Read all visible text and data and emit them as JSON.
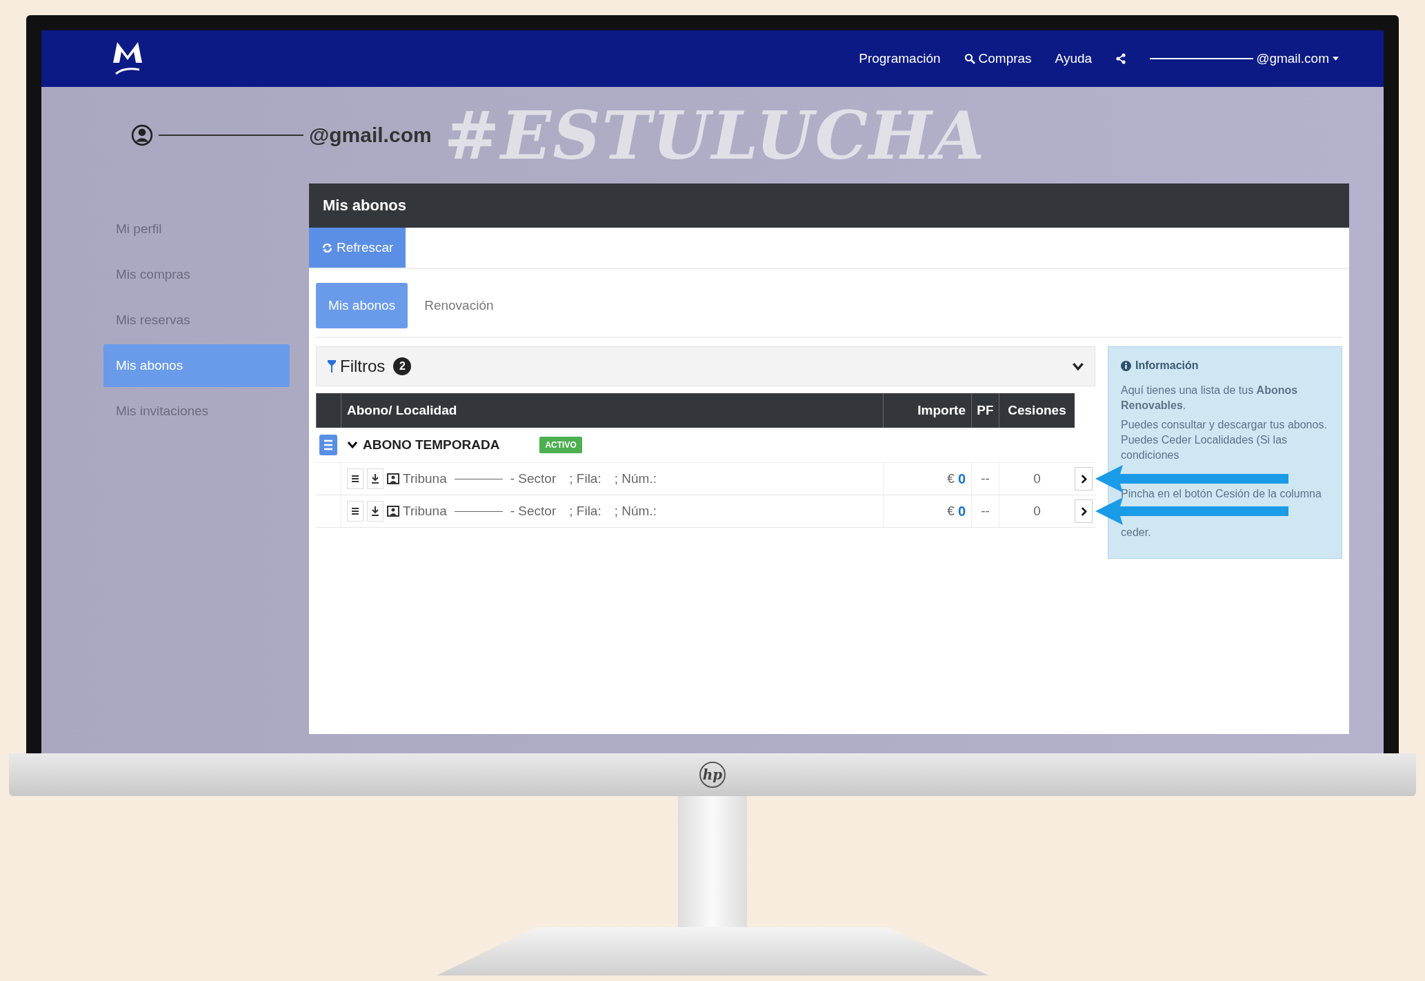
{
  "nav": {
    "links": [
      {
        "label": "Programación",
        "kind": "plain"
      },
      {
        "label": "Compras",
        "kind": "search"
      },
      {
        "label": "Ayuda",
        "kind": "plain"
      }
    ],
    "account": "@gmail.com"
  },
  "profile": {
    "email": "@gmail.com",
    "banner": "#ESTULUCHA"
  },
  "sidebar": {
    "items": [
      {
        "label": "Mi perfil",
        "selected": false
      },
      {
        "label": "Mis compras",
        "selected": false
      },
      {
        "label": "Mis reservas",
        "selected": false
      },
      {
        "label": "Mis abonos",
        "selected": true
      },
      {
        "label": "Mis invitaciones",
        "selected": false
      }
    ]
  },
  "panel": {
    "title": "Mis abonos",
    "refresh": "Refrescar",
    "tabs": [
      {
        "label": "Mis abonos",
        "selected": true
      },
      {
        "label": "Renovación",
        "selected": false
      }
    ],
    "filters": {
      "label": "Filtros",
      "count": "2"
    },
    "table": {
      "columns": [
        "Abono/ Localidad",
        "Importe",
        "PF",
        "Cesiones"
      ],
      "groups": [
        {
          "title": "ABONO TEMPORADA",
          "status": "ACTIVO",
          "expanded": true,
          "rows": [
            {
              "stand": "Tribuna",
              "sector": "- Sector",
              "row": "; Fila:",
              "seat": "; Núm.:",
              "currency": "€",
              "amount": "0",
              "pf": "--",
              "transfers": "0"
            },
            {
              "stand": "Tribuna",
              "sector": "- Sector",
              "row": "; Fila:",
              "seat": "; Núm.:",
              "currency": "€",
              "amount": "0",
              "pf": "--",
              "transfers": "0"
            }
          ]
        }
      ]
    },
    "info": {
      "title": "Información",
      "paragraphs": [
        "Aquí tienes una lista de tus **Abonos Renovables**.",
        "Puedes consultar y descargar tus abonos.",
        "Puedes Ceder Localidades (Si las condiciones",
        "Pincha en el botón Cesión de la columna",
        "ceder."
      ]
    }
  },
  "monitor": {
    "brand": "hp"
  }
}
